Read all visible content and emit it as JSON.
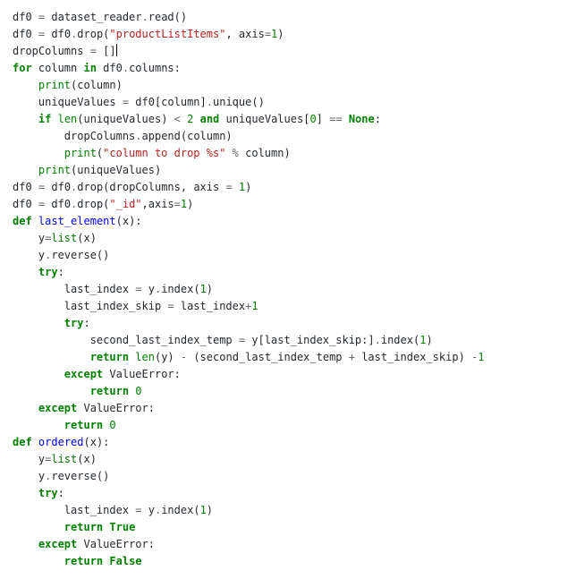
{
  "code": {
    "l1": {
      "a": "df0 ",
      "b": "=",
      "c": " dataset_reader",
      "d": ".",
      "e": "read()"
    },
    "l2": {
      "a": "df0 ",
      "b": "=",
      "c": " df0",
      "d": ".",
      "e": "drop(",
      "f": "\"productListItems\"",
      "g": ", axis",
      "h": "=",
      "i": "1",
      "j": ")"
    },
    "l3": {
      "a": "dropColumns ",
      "b": "=",
      "c": " []"
    },
    "l4": {
      "a": "for",
      "b": " column ",
      "c": "in",
      "d": " df0",
      "e": ".",
      "f": "columns:"
    },
    "l5": {
      "a": "    ",
      "b": "print",
      "c": "(column)"
    },
    "l6": {
      "a": "    uniqueValues ",
      "b": "=",
      "c": " df0[column]",
      "d": ".",
      "e": "unique()"
    },
    "l7": {
      "a": "    ",
      "b": "if",
      "c": " ",
      "d": "len",
      "e": "(uniqueValues) ",
      "f": "<",
      "g": " ",
      "h": "2",
      "i": " ",
      "j": "and",
      "k": " uniqueValues[",
      "l": "0",
      "m": "] ",
      "n": "==",
      "o": " ",
      "p": "None",
      "q": ":"
    },
    "l8": {
      "a": "        dropColumns",
      "b": ".",
      "c": "append(column)"
    },
    "l9": {
      "a": "        ",
      "b": "print",
      "c": "(",
      "d": "\"column to drop %s\"",
      "e": " ",
      "f": "%",
      "g": " column)"
    },
    "l10": {
      "a": "    ",
      "b": "print",
      "c": "(uniqueValues)"
    },
    "l11": {
      "a": "df0 ",
      "b": "=",
      "c": " df0",
      "d": ".",
      "e": "drop(dropColumns, axis ",
      "f": "=",
      "g": " ",
      "h": "1",
      "i": ")"
    },
    "l12": {
      "a": "df0 ",
      "b": "=",
      "c": " df0",
      "d": ".",
      "e": "drop(",
      "f": "\"_id\"",
      "g": ",axis",
      "h": "=",
      "i": "1",
      "j": ")"
    },
    "l13": {
      "a": "def",
      "b": " ",
      "c": "last_element",
      "d": "(x):"
    },
    "l14": {
      "a": "    y",
      "b": "=",
      "c": "list",
      "d": "(x)"
    },
    "l15": {
      "a": "    y",
      "b": ".",
      "c": "reverse()"
    },
    "l16": {
      "a": "    ",
      "b": "try",
      "c": ":"
    },
    "l17": {
      "a": "        last_index ",
      "b": "=",
      "c": " y",
      "d": ".",
      "e": "index(",
      "f": "1",
      "g": ")"
    },
    "l18": {
      "a": "        last_index_skip ",
      "b": "=",
      "c": " last_index",
      "d": "+",
      "e": "1"
    },
    "l19": {
      "a": "        ",
      "b": "try",
      "c": ":"
    },
    "l20": {
      "a": "            second_last_index_temp ",
      "b": "=",
      "c": " y[last_index_skip:]",
      "d": ".",
      "e": "index(",
      "f": "1",
      "g": ")"
    },
    "l21": {
      "a": "            ",
      "b": "return",
      "c": " ",
      "d": "len",
      "e": "(y) ",
      "f": "-",
      "g": " (second_last_index_temp ",
      "h": "+",
      "i": " last_index_skip) ",
      "j": "-",
      "k": "1"
    },
    "l22": {
      "a": "        ",
      "b": "except",
      "c": " ",
      "d": "ValueError",
      "e": ":"
    },
    "l23": {
      "a": "            ",
      "b": "return",
      "c": " ",
      "d": "0"
    },
    "l24": {
      "a": "    ",
      "b": "except",
      "c": " ",
      "d": "ValueError",
      "e": ":"
    },
    "l25": {
      "a": "        ",
      "b": "return",
      "c": " ",
      "d": "0"
    },
    "l26": {
      "a": "def",
      "b": " ",
      "c": "ordered",
      "d": "(x):"
    },
    "l27": {
      "a": "    y",
      "b": "=",
      "c": "list",
      "d": "(x)"
    },
    "l28": {
      "a": "    y",
      "b": ".",
      "c": "reverse()"
    },
    "l29": {
      "a": "    ",
      "b": "try",
      "c": ":"
    },
    "l30": {
      "a": "        last_index ",
      "b": "=",
      "c": " y",
      "d": ".",
      "e": "index(",
      "f": "1",
      "g": ")"
    },
    "l31": {
      "a": "        ",
      "b": "return",
      "c": " ",
      "d": "True"
    },
    "l32": {
      "a": "    ",
      "b": "except",
      "c": " ",
      "d": "ValueError",
      "e": ":"
    },
    "l33": {
      "a": "        ",
      "b": "return",
      "c": " ",
      "d": "False"
    }
  }
}
